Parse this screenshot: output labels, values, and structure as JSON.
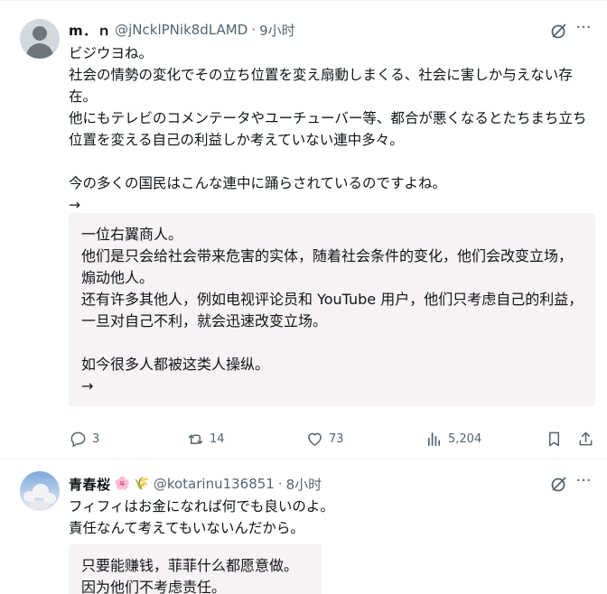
{
  "posts": [
    {
      "name": "m．ｎ",
      "handle": "@jNcklPNik8dLAMD",
      "separator": "·",
      "time": "9小时",
      "text": "ビジウヨね。\n社会の情勢の変化でその立ち位置を変え扇動しまくる、社会に害しか与えない存在。\n他にもテレビのコメンテータやユーチューバー等、都合が悪くなるとたちまち立ち位置を変える自己の利益しか考えていない連中多々。\n\n今の多くの国民はこんな連中に踊らされているのですよね。\n→",
      "translation": "一位右翼商人。\n他们是只会给社会带来危害的实体，随着社会条件的变化，他们会改变立场，煽动他人。\n还有许多其他人，例如电视评论员和 YouTube 用户，他们只考虑自己的利益，一旦对自己不利，就会迅速改变立场。\n\n如今很多人都被这类人操纵。\n→",
      "stats": {
        "replies": "3",
        "reposts": "14",
        "likes": "73",
        "views": "5,204"
      }
    },
    {
      "name": "青春桜",
      "name_emojis": "🌸 🌾",
      "handle": "@kotarinu136851",
      "separator": "·",
      "time": "8小时",
      "text": "フィフィはお金になれば何でも良いのよ。\n責任なんて考えてもいないんだから。",
      "translation": "只要能赚钱，菲菲什么都愿意做。\n因为他们不考虑责任。"
    }
  ],
  "icons": {
    "grok": "grok-icon",
    "more": "more-icon",
    "reply": "reply-icon",
    "repost": "repost-icon",
    "like": "heart-icon",
    "views": "views-icon",
    "bookmark": "bookmark-icon",
    "share": "share-icon"
  },
  "colors": {
    "secondary_text": "#536471",
    "translation_bg": "#f7f2f3",
    "border": "#eff3f4"
  }
}
